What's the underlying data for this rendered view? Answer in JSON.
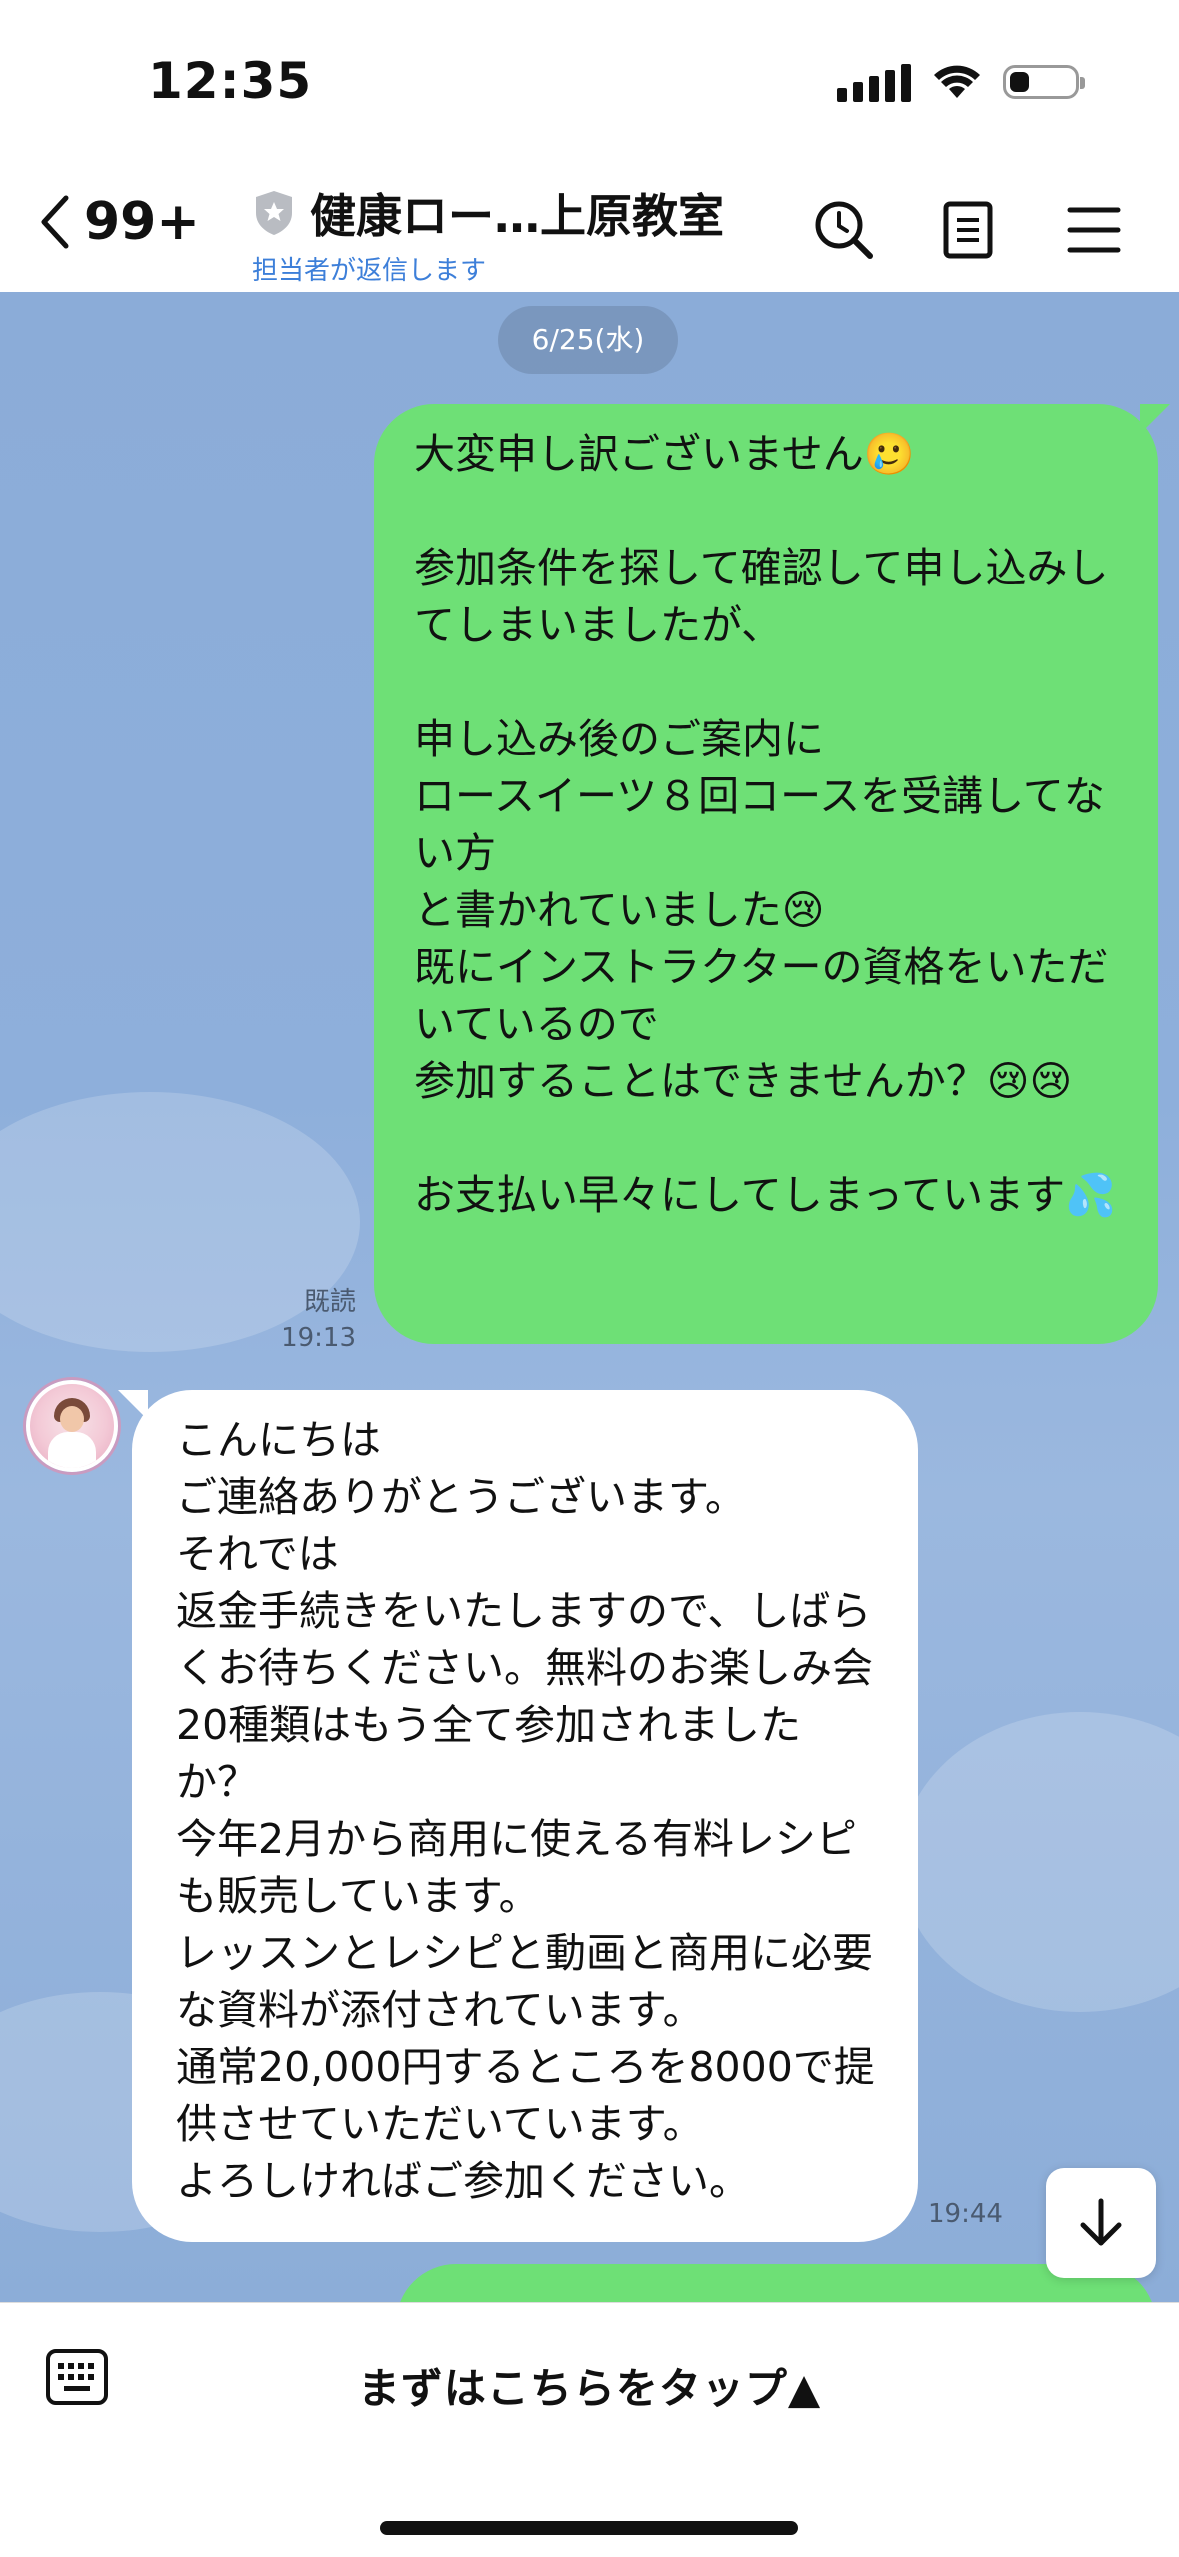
{
  "status_bar": {
    "time": "12:35",
    "battery_level": 0.3
  },
  "header": {
    "back_count": "99+",
    "title": "健康ロー…上原教室",
    "subtitle": "担当者が返信します"
  },
  "chat": {
    "date": "6/25(水)",
    "outgoing_message": "大変申し訳ございません🥲\n\n参加条件を探して確認して申し込みしてしまいましたが、\n\n申し込み後のご案内に\nロースイーツ８回コースを受講してない方\nと書かれていました😢\n既にインストラクターの資格をいただいているので\n参加することはできませんか？😢😢\n\nお支払い早々にしてしまっています💦",
    "outgoing_read": "既読",
    "outgoing_time": "19:13",
    "incoming_message": "こんにちは\nご連絡ありがとうございます。\nそれでは\n返金手続きをいたしますので、しばらくお待ちください。無料のお楽しみ会20種類はもう全て参加されましたか？\n今年2月から商用に使える有料レシピも販売しています。\nレッスンとレシピと動画と商用に必要な資料が添付されています。\n通常20,000円するところを8000で提供させていただいています。\nよろしければご参加ください。",
    "incoming_time": "19:44"
  },
  "footer": {
    "menu_label": "まずはこちらをタップ▲"
  },
  "colors": {
    "outgoing_bubble": "#6ee076",
    "chat_bg": "#8bacd8",
    "link_blue": "#3d7fd9"
  },
  "icons": [
    "back-chevron-icon",
    "shield-icon",
    "search-icon",
    "notes-icon",
    "menu-icon",
    "scroll-down-icon",
    "keyboard-icon"
  ]
}
